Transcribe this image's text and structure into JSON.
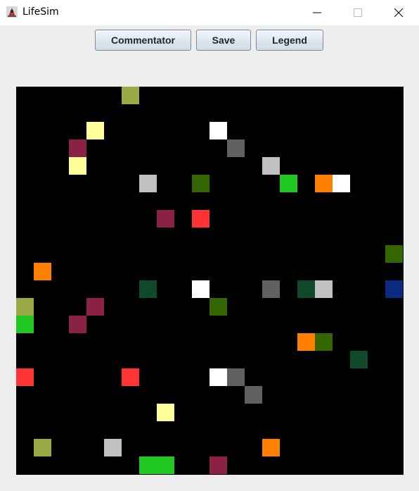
{
  "window": {
    "title": "LifeSim",
    "icon": "java-duke-icon"
  },
  "toolbar": {
    "commentator_label": "Commentator",
    "save_label": "Save",
    "legend_label": "Legend"
  },
  "grid": {
    "columns": 22,
    "rows": 22,
    "background": "#000000",
    "cells": [
      {
        "col": 6,
        "row": 0,
        "color": "#9aaa44"
      },
      {
        "col": 4,
        "row": 2,
        "color": "#ffff99"
      },
      {
        "col": 11,
        "row": 2,
        "color": "#ffffff"
      },
      {
        "col": 3,
        "row": 3,
        "color": "#8b2145"
      },
      {
        "col": 12,
        "row": 3,
        "color": "#606060"
      },
      {
        "col": 3,
        "row": 4,
        "color": "#ffff99"
      },
      {
        "col": 14,
        "row": 4,
        "color": "#c0c0c0"
      },
      {
        "col": 7,
        "row": 5,
        "color": "#c0c0c0"
      },
      {
        "col": 10,
        "row": 5,
        "color": "#336600"
      },
      {
        "col": 15,
        "row": 5,
        "color": "#1ec81e"
      },
      {
        "col": 17,
        "row": 5,
        "color": "#ff8000"
      },
      {
        "col": 18,
        "row": 5,
        "color": "#ffffff"
      },
      {
        "col": 8,
        "row": 7,
        "color": "#8b2145"
      },
      {
        "col": 10,
        "row": 7,
        "color": "#ff3333"
      },
      {
        "col": 21,
        "row": 9,
        "color": "#336600"
      },
      {
        "col": 1,
        "row": 10,
        "color": "#ff8000"
      },
      {
        "col": 7,
        "row": 11,
        "color": "#0f4a2a"
      },
      {
        "col": 10,
        "row": 11,
        "color": "#ffffff"
      },
      {
        "col": 14,
        "row": 11,
        "color": "#606060"
      },
      {
        "col": 16,
        "row": 11,
        "color": "#0f4a2a"
      },
      {
        "col": 17,
        "row": 11,
        "color": "#c0c0c0"
      },
      {
        "col": 21,
        "row": 11,
        "color": "#0a2a80"
      },
      {
        "col": 0,
        "row": 12,
        "color": "#9aaa44"
      },
      {
        "col": 4,
        "row": 12,
        "color": "#8b2145"
      },
      {
        "col": 11,
        "row": 12,
        "color": "#336600"
      },
      {
        "col": 0,
        "row": 13,
        "color": "#1ec81e"
      },
      {
        "col": 3,
        "row": 13,
        "color": "#8b2145"
      },
      {
        "col": 16,
        "row": 14,
        "color": "#ff8000"
      },
      {
        "col": 17,
        "row": 14,
        "color": "#336600"
      },
      {
        "col": 19,
        "row": 15,
        "color": "#0f4a2a"
      },
      {
        "col": 0,
        "row": 16,
        "color": "#ff3333"
      },
      {
        "col": 6,
        "row": 16,
        "color": "#ff3333"
      },
      {
        "col": 11,
        "row": 16,
        "color": "#ffffff"
      },
      {
        "col": 12,
        "row": 16,
        "color": "#606060"
      },
      {
        "col": 13,
        "row": 17,
        "color": "#606060"
      },
      {
        "col": 8,
        "row": 18,
        "color": "#ffff99"
      },
      {
        "col": 1,
        "row": 20,
        "color": "#9aaa44"
      },
      {
        "col": 5,
        "row": 20,
        "color": "#c0c0c0"
      },
      {
        "col": 14,
        "row": 20,
        "color": "#ff8000"
      },
      {
        "col": 7,
        "row": 21,
        "color": "#1ec81e"
      },
      {
        "col": 8,
        "row": 21,
        "color": "#1ec81e"
      },
      {
        "col": 11,
        "row": 21,
        "color": "#8b2145"
      }
    ]
  }
}
